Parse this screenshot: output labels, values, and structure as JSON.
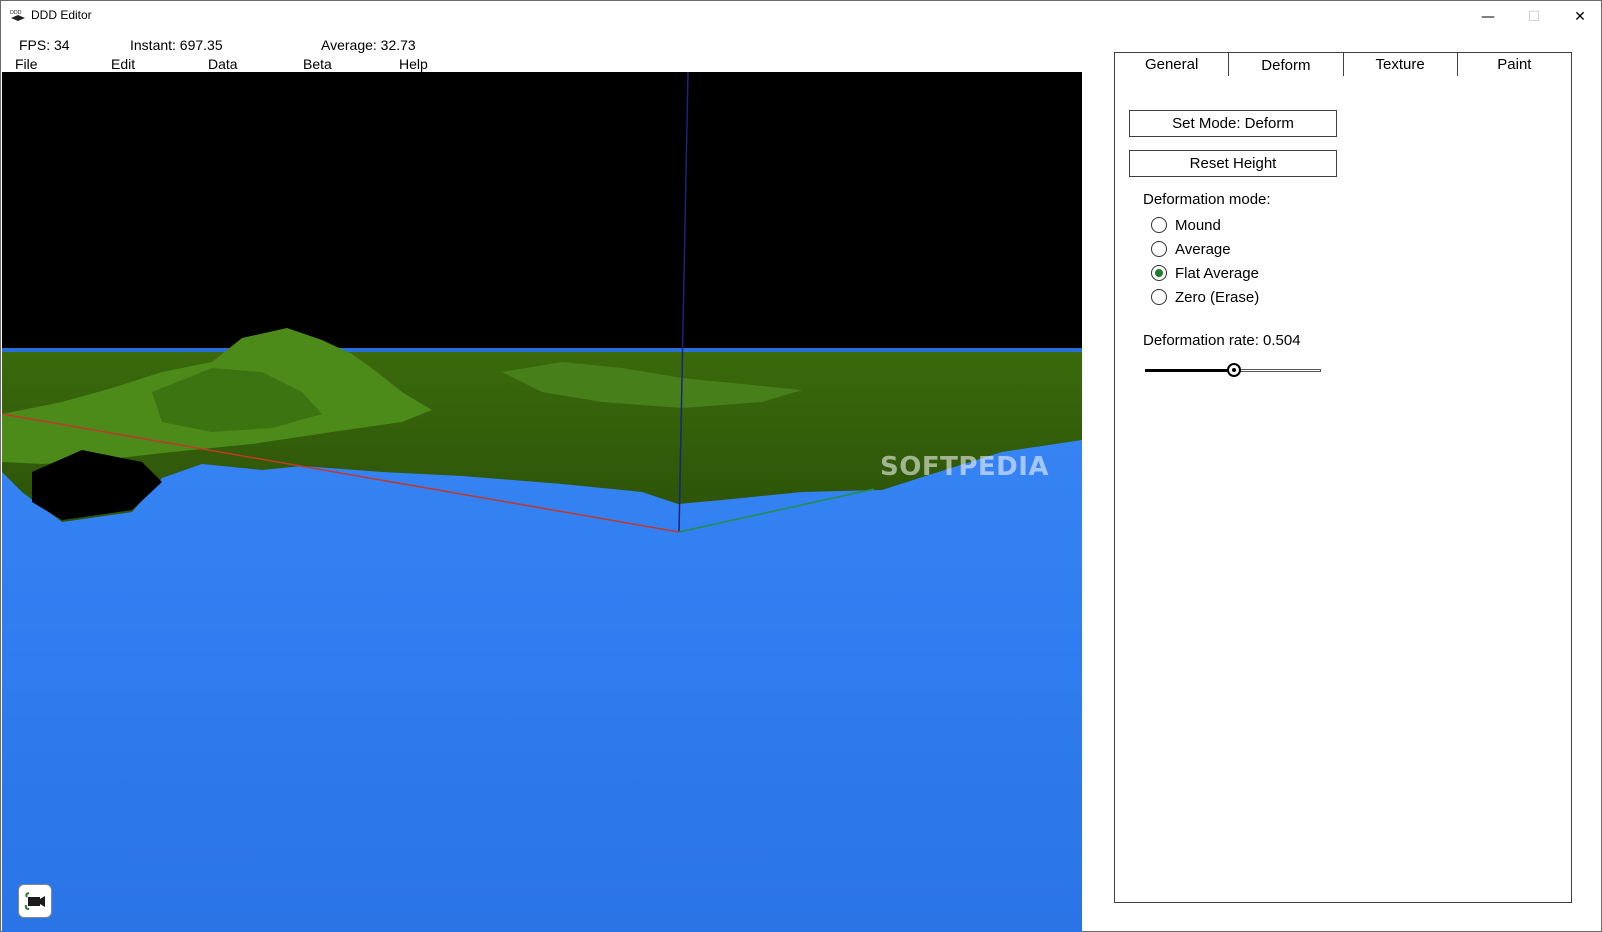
{
  "window": {
    "title": "DDD Editor",
    "icon": "ddd-app-icon",
    "controls": {
      "minimize": "—",
      "maximize": "☐",
      "close": "✕"
    }
  },
  "stats": {
    "fps": "FPS: 34",
    "instant": "Instant: 697.35",
    "average": "Average: 32.73"
  },
  "menu": [
    {
      "label": "File"
    },
    {
      "label": "Edit"
    },
    {
      "label": "Data"
    },
    {
      "label": "Beta"
    },
    {
      "label": "Help"
    }
  ],
  "viewport": {
    "watermark": "SOFTPEDIA",
    "colors": {
      "sky": "#000000",
      "water": "#2c7bf0",
      "terrain": "#3f7a10",
      "axis_x": "#c0392b",
      "axis_y": "#1f8f4a",
      "axis_z": "#1a237e"
    },
    "camera_button_icon": "camera-icon"
  },
  "panel": {
    "tabs": [
      {
        "label": "General",
        "active": false
      },
      {
        "label": "Deform",
        "active": true
      },
      {
        "label": "Texture",
        "active": false
      },
      {
        "label": "Paint",
        "active": false
      }
    ],
    "set_mode_button": "Set Mode: Deform",
    "reset_height_button": "Reset Height",
    "deformation_mode_label": "Deformation mode:",
    "modes": [
      {
        "label": "Mound",
        "selected": false
      },
      {
        "label": "Average",
        "selected": false
      },
      {
        "label": "Flat Average",
        "selected": true
      },
      {
        "label": "Zero (Erase)",
        "selected": false
      }
    ],
    "rate_label": "Deformation rate: 0.504",
    "rate_value": 0.504,
    "accent": "#1e7d2e"
  }
}
